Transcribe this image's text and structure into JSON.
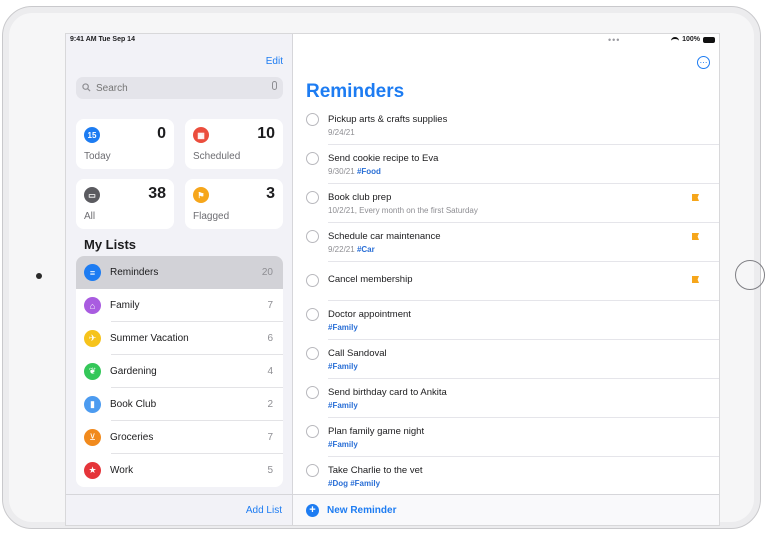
{
  "status_bar": {
    "time": "9:41 AM  Tue Sep 14",
    "dots": "•••",
    "battery": "100%"
  },
  "sidebar": {
    "edit_label": "Edit",
    "search_placeholder": "Search",
    "smart_lists": [
      {
        "label": "Today",
        "count": "0",
        "icon": "calendar-today-icon",
        "icon_glyph": "15",
        "color": "#1d7cf2"
      },
      {
        "label": "Scheduled",
        "count": "10",
        "icon": "calendar-scheduled-icon",
        "icon_glyph": "▦",
        "color": "#eb4d3d"
      },
      {
        "label": "All",
        "count": "38",
        "icon": "tray-icon",
        "icon_glyph": "▭",
        "color": "#5b5b60"
      },
      {
        "label": "Flagged",
        "count": "3",
        "icon": "flag-icon",
        "icon_glyph": "⚑",
        "color": "#f6a61b"
      }
    ],
    "my_lists_title": "My Lists",
    "lists": [
      {
        "name": "Reminders",
        "count": "20",
        "icon": "list-bullet-icon",
        "icon_glyph": "≡",
        "color": "#1d7cf2",
        "selected": true
      },
      {
        "name": "Family",
        "count": "7",
        "icon": "house-icon",
        "icon_glyph": "⌂",
        "color": "#a95ce0",
        "selected": false
      },
      {
        "name": "Summer Vacation",
        "count": "6",
        "icon": "airplane-icon",
        "icon_glyph": "✈",
        "color": "#f6c31b",
        "selected": false
      },
      {
        "name": "Gardening",
        "count": "4",
        "icon": "leaf-icon",
        "icon_glyph": "❦",
        "color": "#34c759",
        "selected": false
      },
      {
        "name": "Book Club",
        "count": "2",
        "icon": "bookmark-icon",
        "icon_glyph": "▮",
        "color": "#4c9bf0",
        "selected": false
      },
      {
        "name": "Groceries",
        "count": "7",
        "icon": "cart-icon",
        "icon_glyph": "⊻",
        "color": "#f18a1d",
        "selected": false
      },
      {
        "name": "Work",
        "count": "5",
        "icon": "star-icon",
        "icon_glyph": "★",
        "color": "#e5353a",
        "selected": false
      }
    ],
    "add_list_label": "Add List"
  },
  "main": {
    "more_glyph": "⋯",
    "title": "Reminders",
    "reminders": [
      {
        "title": "Pickup arts & crafts supplies",
        "date": "9/24/21",
        "tags": "",
        "flagged": false
      },
      {
        "title": "Send cookie recipe to Eva",
        "date": "9/30/21",
        "tags": "#Food",
        "flagged": false
      },
      {
        "title": "Book club prep",
        "date": "10/2/21, Every month on the first Saturday",
        "tags": "",
        "flagged": true
      },
      {
        "title": "Schedule car maintenance",
        "date": "9/22/21",
        "tags": "#Car",
        "flagged": true
      },
      {
        "title": "Cancel membership",
        "date": "",
        "tags": "",
        "flagged": true
      },
      {
        "title": "Doctor appointment",
        "date": "",
        "tags": "#Family",
        "flagged": false
      },
      {
        "title": "Call Sandoval",
        "date": "",
        "tags": "#Family",
        "flagged": false
      },
      {
        "title": "Send birthday card to Ankita",
        "date": "",
        "tags": "#Family",
        "flagged": false
      },
      {
        "title": "Plan family game night",
        "date": "",
        "tags": "#Family",
        "flagged": false
      },
      {
        "title": "Take Charlie to the vet",
        "date": "",
        "tags": "#Dog #Family",
        "flagged": false
      }
    ],
    "new_reminder_glyph": "+",
    "new_reminder_label": "New Reminder"
  }
}
